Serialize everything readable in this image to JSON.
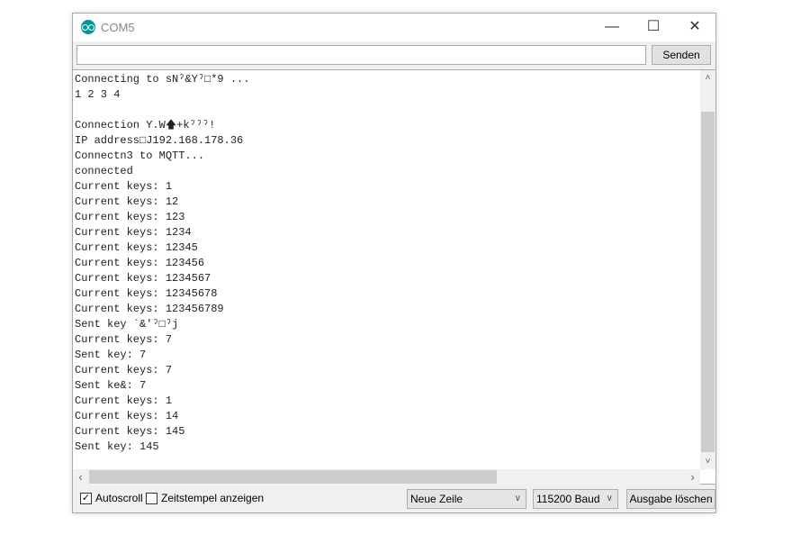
{
  "window": {
    "title": "COM5",
    "minimize": "—",
    "maximize": "☐",
    "close": "✕"
  },
  "input": {
    "value": "",
    "send_label": "Senden"
  },
  "output_lines": [
    "Connecting to sNˀ&Yˀ□*9 ...",
    "1 2 3 4",
    "",
    "Connection Y.W🡅+kˀˀˀ!",
    "IP address□J192.168.178.36",
    "Connectn3 to MQTT...",
    "connected",
    "Current keys: 1",
    "Current keys: 12",
    "Current keys: 123",
    "Current keys: 1234",
    "Current keys: 12345",
    "Current keys: 123456",
    "Current keys: 1234567",
    "Current keys: 12345678",
    "Current keys: 123456789",
    "Sent key `&'ˀ□ˀj",
    "Current keys: 7",
    "Sent key: 7",
    "Current keys: 7",
    "Sent ke&: 7",
    "Current keys: 1",
    "Current keys: 14",
    "Current keys: 145",
    "Sent key: 145"
  ],
  "bottom": {
    "autoscroll": {
      "label": "Autoscroll",
      "checked": true
    },
    "timestamp": {
      "label": "Zeitstempel anzeigen",
      "checked": false
    },
    "line_ending": "Neue Zeile",
    "baud": "115200 Baud",
    "clear_label": "Ausgabe löschen"
  }
}
